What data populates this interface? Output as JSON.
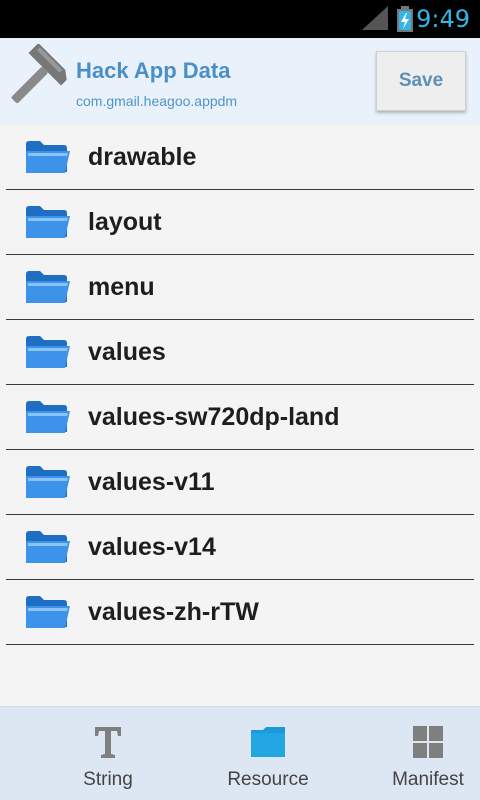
{
  "status_bar": {
    "time": "9:49"
  },
  "header": {
    "title": "Hack App Data",
    "subtitle": "com.gmail.heagoo.appdm",
    "save_label": "Save"
  },
  "folders": [
    {
      "label": "drawable"
    },
    {
      "label": "layout"
    },
    {
      "label": "menu"
    },
    {
      "label": "values"
    },
    {
      "label": "values-sw720dp-land"
    },
    {
      "label": "values-v11"
    },
    {
      "label": "values-v14"
    },
    {
      "label": "values-zh-rTW"
    }
  ],
  "tabs": [
    {
      "label": "String",
      "icon": "text-icon"
    },
    {
      "label": "Resource",
      "icon": "folder-icon",
      "active": true
    },
    {
      "label": "Manifest",
      "icon": "grid-icon"
    }
  ],
  "colors": {
    "accent": "#33b5e5",
    "header_bg": "#e9f1fa",
    "title": "#4a8fc7",
    "folder": "#2f86e0"
  }
}
